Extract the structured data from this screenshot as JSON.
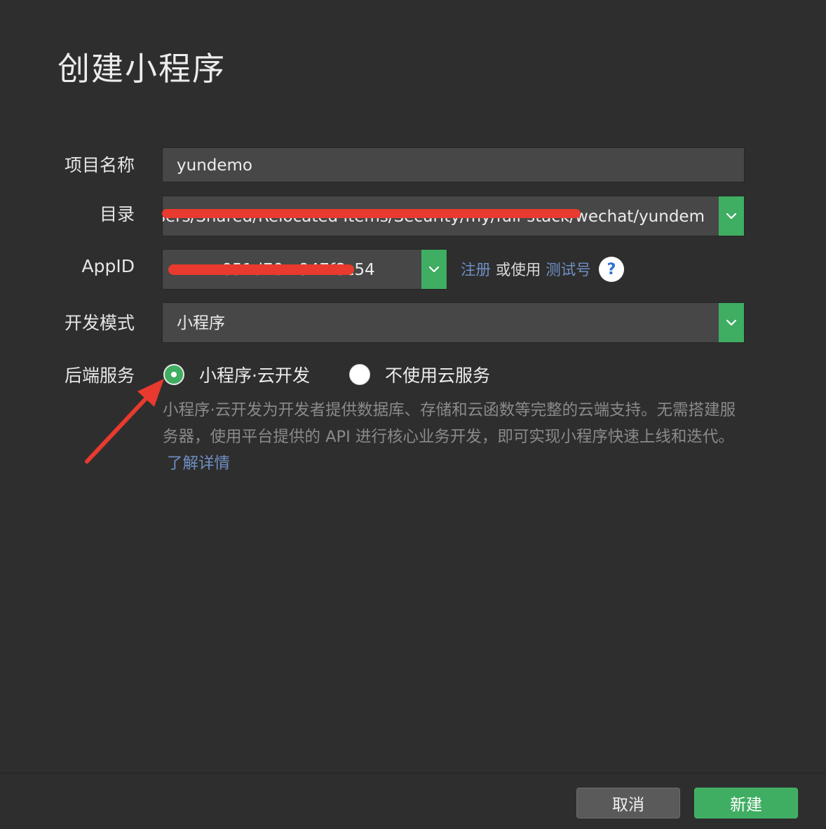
{
  "dialog": {
    "title": "创建小程序"
  },
  "form": {
    "project_name": {
      "label": "项目名称",
      "value": "yundemo"
    },
    "directory": {
      "label": "目录",
      "value": "/Users/Shared/Relocated Items/Security/my/full-stack/wechat/yundem"
    },
    "appid": {
      "label": "AppID",
      "value": "wx051d70...947f8c54",
      "register_link": "注册",
      "or_use": "或使用",
      "test_link": "测试号",
      "help_glyph": "?"
    },
    "dev_mode": {
      "label": "开发模式",
      "value": "小程序"
    },
    "backend": {
      "label": "后端服务",
      "options": [
        {
          "label": "小程序·云开发",
          "selected": true
        },
        {
          "label": "不使用云服务",
          "selected": false
        }
      ],
      "description": "小程序·云开发为开发者提供数据库、存储和云函数等完整的云端支持。无需搭建服务器，使用平台提供的 API 进行核心业务开发，即可实现小程序快速上线和迭代。",
      "learn_more": "了解详情"
    }
  },
  "footer": {
    "cancel_label": "取消",
    "create_label": "新建"
  },
  "colors": {
    "accent": "#3fad62",
    "link": "#6f8fc4",
    "annotation": "#e83a2e",
    "background": "#2e2e2e"
  },
  "icons": {
    "dropdown": "chevron-down-icon",
    "help": "question-icon",
    "annotation": "red-arrow-icon"
  }
}
